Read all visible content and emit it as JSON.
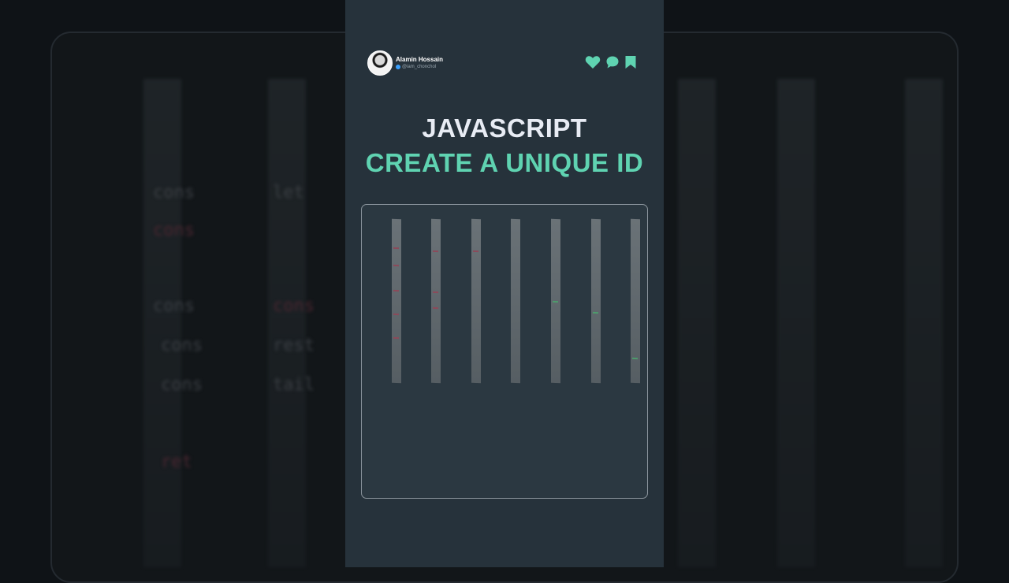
{
  "profile": {
    "name": "Alamin Hossain",
    "handle": "@iam_chonchol"
  },
  "actions": [
    {
      "icon": "heart-icon"
    },
    {
      "icon": "comment-icon"
    },
    {
      "icon": "bookmark-icon"
    }
  ],
  "title": {
    "line1": "JAVASCRIPT",
    "line2": "CREATE A UNIQUE ID"
  },
  "colors": {
    "panel_bg": "#26323b",
    "accent": "#5fd3b1",
    "title_text": "#e8ecf4",
    "background": "#0f1317"
  }
}
